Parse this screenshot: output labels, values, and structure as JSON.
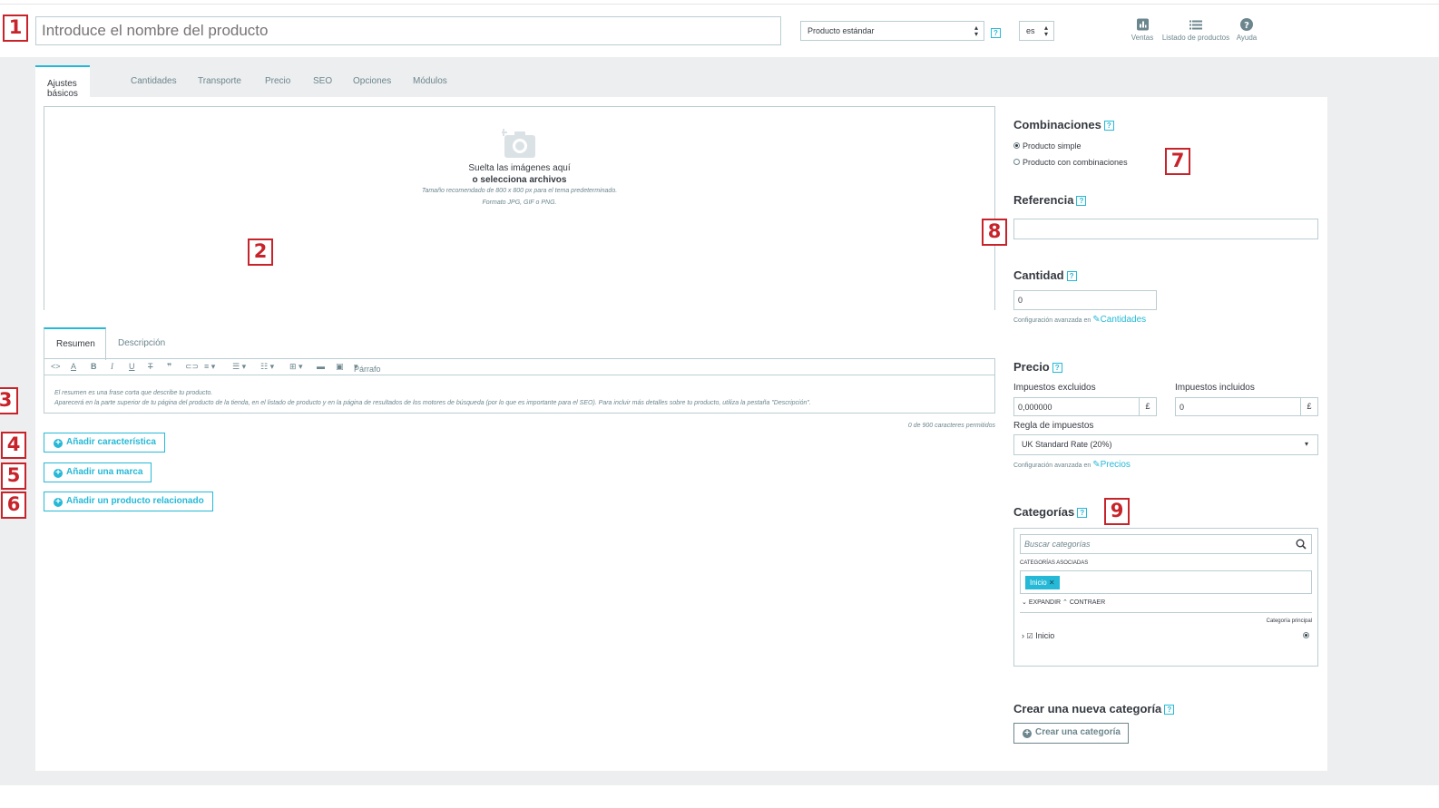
{
  "header": {
    "name_placeholder": "Introduce el nombre del producto",
    "product_type": "Producto estándar",
    "language": "es",
    "links": [
      {
        "label": "Ventas",
        "icon": "bar-chart-icon"
      },
      {
        "label": "Listado de productos",
        "icon": "list-icon"
      },
      {
        "label": "Ayuda",
        "icon": "help-circle-icon"
      }
    ]
  },
  "tabs": [
    "Ajustes básicos",
    "Cantidades",
    "Transporte",
    "Precio",
    "SEO",
    "Opciones",
    "Módulos"
  ],
  "dropzone": {
    "line1": "Suelta las imágenes aquí",
    "line2": "o selecciona archivos",
    "line3": "Tamaño recomendado de 800 x 800 px para el tema predeterminado.",
    "line4": "Formato JPG, GIF o PNG."
  },
  "description_tabs": [
    "Resumen",
    "Descripción"
  ],
  "editor": {
    "format_label": "Párrafo",
    "placeholder_line1": "El resumen es una frase corta que describe tu producto.",
    "placeholder_line2": "Aparecerá en la parte superior de tu página del producto de la tienda, en el listado de producto y en la página de resultados de los motores de búsqueda (por lo que es importante para el SEO). Para incluir más detalles sobre tu producto, utiliza la pestaña \"Descripción\".",
    "char_count": "0 de 900 caracteres permitidos"
  },
  "buttons": {
    "add_feature": "Añadir característica",
    "add_brand": "Añadir una marca",
    "add_related": "Añadir un producto relacionado"
  },
  "combinations": {
    "title": "Combinaciones",
    "simple": "Producto simple",
    "with_combinations": "Producto con combinaciones"
  },
  "reference": {
    "title": "Referencia",
    "value": ""
  },
  "quantity": {
    "title": "Cantidad",
    "value": "0",
    "note": "Configuración avanzada en",
    "link": "Cantidades"
  },
  "price": {
    "title": "Precio",
    "excl_label": "Impuestos excluidos",
    "excl_value": "0,000000",
    "incl_label": "Impuestos incluidos",
    "incl_value": "0",
    "currency": "£",
    "tax_rule_label": "Regla de impuestos",
    "tax_rule_value": "UK Standard Rate (20%)",
    "note": "Configuración avanzada en",
    "link": "Precios"
  },
  "categories": {
    "title": "Categorías",
    "search_placeholder": "Buscar categorías",
    "associated_label": "CATEGORÍAS ASOCIADAS",
    "tag": "Inicio",
    "expand": "EXPANDIR",
    "collapse": "CONTRAER",
    "main_label": "Categoría principal",
    "tree_item": "Inicio"
  },
  "new_category": {
    "title": "Crear una nueva categoría",
    "button": "Crear una categoría"
  },
  "markers": [
    "1",
    "2",
    "3",
    "4",
    "5",
    "6",
    "7",
    "8",
    "9"
  ],
  "colors": {
    "accent": "#25b9d7",
    "marker": "#c7232a",
    "background": "#eceeef"
  }
}
